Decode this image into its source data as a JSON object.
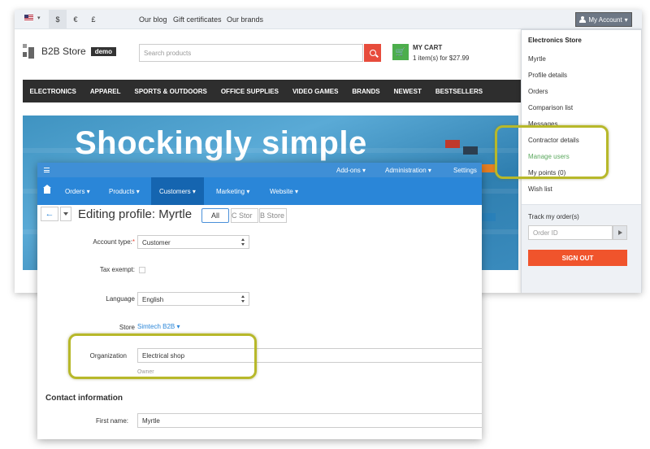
{
  "storefront": {
    "currencies": [
      "$",
      "€",
      "£"
    ],
    "top_links": [
      "Our blog",
      "Gift certificates",
      "Our brands"
    ],
    "account_button": "My Account",
    "logo_text": "B2B Store",
    "logo_badge": "demo",
    "search_placeholder": "Search products",
    "cart": {
      "title": "MY CART",
      "summary": "1 item(s) for $27.99"
    },
    "categories": [
      "ELECTRONICS",
      "APPAREL",
      "SPORTS & OUTDOORS",
      "OFFICE SUPPLIES",
      "VIDEO GAMES",
      "BRANDS",
      "NEWEST",
      "BESTSELLERS"
    ],
    "hero_title": "Shockingly simple"
  },
  "account_menu": {
    "header": "Electronics Store",
    "items": [
      "Myrtle",
      "Profile details",
      "Orders",
      "Comparison list",
      "Messages",
      "Contractor details",
      "Manage users",
      "My points (0)",
      "Wish list"
    ],
    "track_title": "Track my order(s)",
    "order_placeholder": "Order ID",
    "signout": "SIGN OUT"
  },
  "admin": {
    "top_menu": [
      "Add-ons",
      "Administration",
      "Settings"
    ],
    "nav": [
      "Orders",
      "Products",
      "Customers",
      "Marketing",
      "Website"
    ],
    "active_nav": "Customers",
    "page_title": "Editing profile: Myrtle",
    "store_tabs": [
      "All",
      "C Stor",
      "B Store"
    ],
    "form": {
      "account_type_label": "Account type:",
      "account_type_required": "*",
      "account_type_value": "Customer",
      "tax_exempt_label": "Tax exempt:",
      "language_label": "Language",
      "language_value": "English",
      "store_label": "Store",
      "store_value": "Simtech B2B",
      "organization_label": "Organization",
      "organization_value": "Electrical shop",
      "organization_hint": "Owner",
      "contact_heading": "Contact information",
      "first_name_label": "First name:",
      "first_name_value": "Myrtle"
    }
  },
  "colors": {
    "highlight": "#b7b82a",
    "admin_blue": "#2a86d8",
    "signout_orange": "#f0542c",
    "cart_green": "#4cae4c",
    "search_red": "#e74c3c"
  },
  "icons": [
    "us-flag-icon",
    "person-icon",
    "magnify-icon",
    "cart-icon",
    "hamburger-icon",
    "home-icon",
    "arrow-left-icon",
    "chevron-down-icon",
    "arrow-right-icon"
  ]
}
